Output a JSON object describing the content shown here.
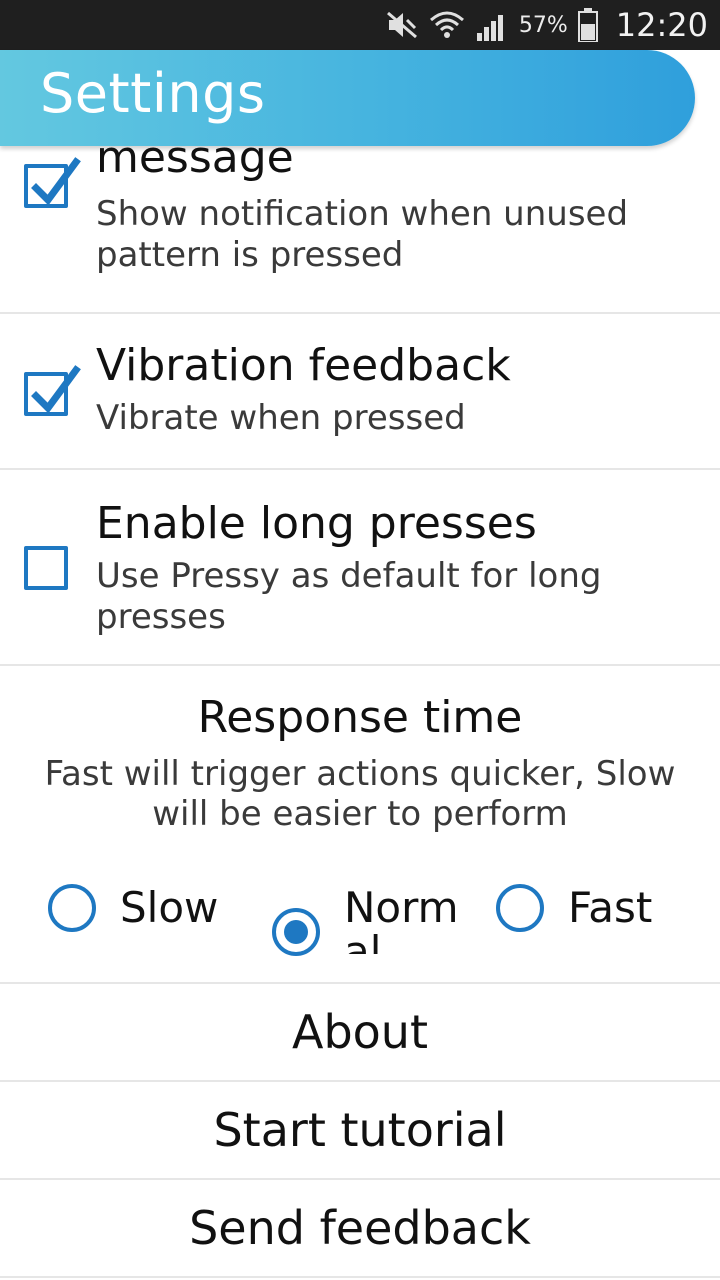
{
  "status_bar": {
    "battery_percent": "57%",
    "time": "12:20",
    "icons": [
      "mute-icon",
      "wifi-icon",
      "signal-icon",
      "battery-icon"
    ]
  },
  "app_bar": {
    "title": "Settings"
  },
  "settings": [
    {
      "title": "message",
      "subtitle": "Show notification when unused pattern is pressed",
      "checked": true
    },
    {
      "title": "Vibration feedback",
      "subtitle": "Vibrate when pressed",
      "checked": true
    },
    {
      "title": "Enable long presses",
      "subtitle": "Use Pressy as default for long presses",
      "checked": false
    }
  ],
  "response_time": {
    "title": "Response time",
    "description_line1": "Fast will trigger actions quicker, Slow",
    "description_line2": "will be easier to perform",
    "options": [
      {
        "label": "Slow",
        "selected": false
      },
      {
        "label_line1": "Norm",
        "label_line2": "al",
        "selected": true
      },
      {
        "label": "Fast",
        "selected": false
      }
    ]
  },
  "actions": {
    "about": "About",
    "tutorial": "Start tutorial",
    "feedback": "Send feedback"
  },
  "colors": {
    "accent": "#1e78c2",
    "appbar_start": "#63c8e0",
    "appbar_end": "#2f9fdc"
  }
}
